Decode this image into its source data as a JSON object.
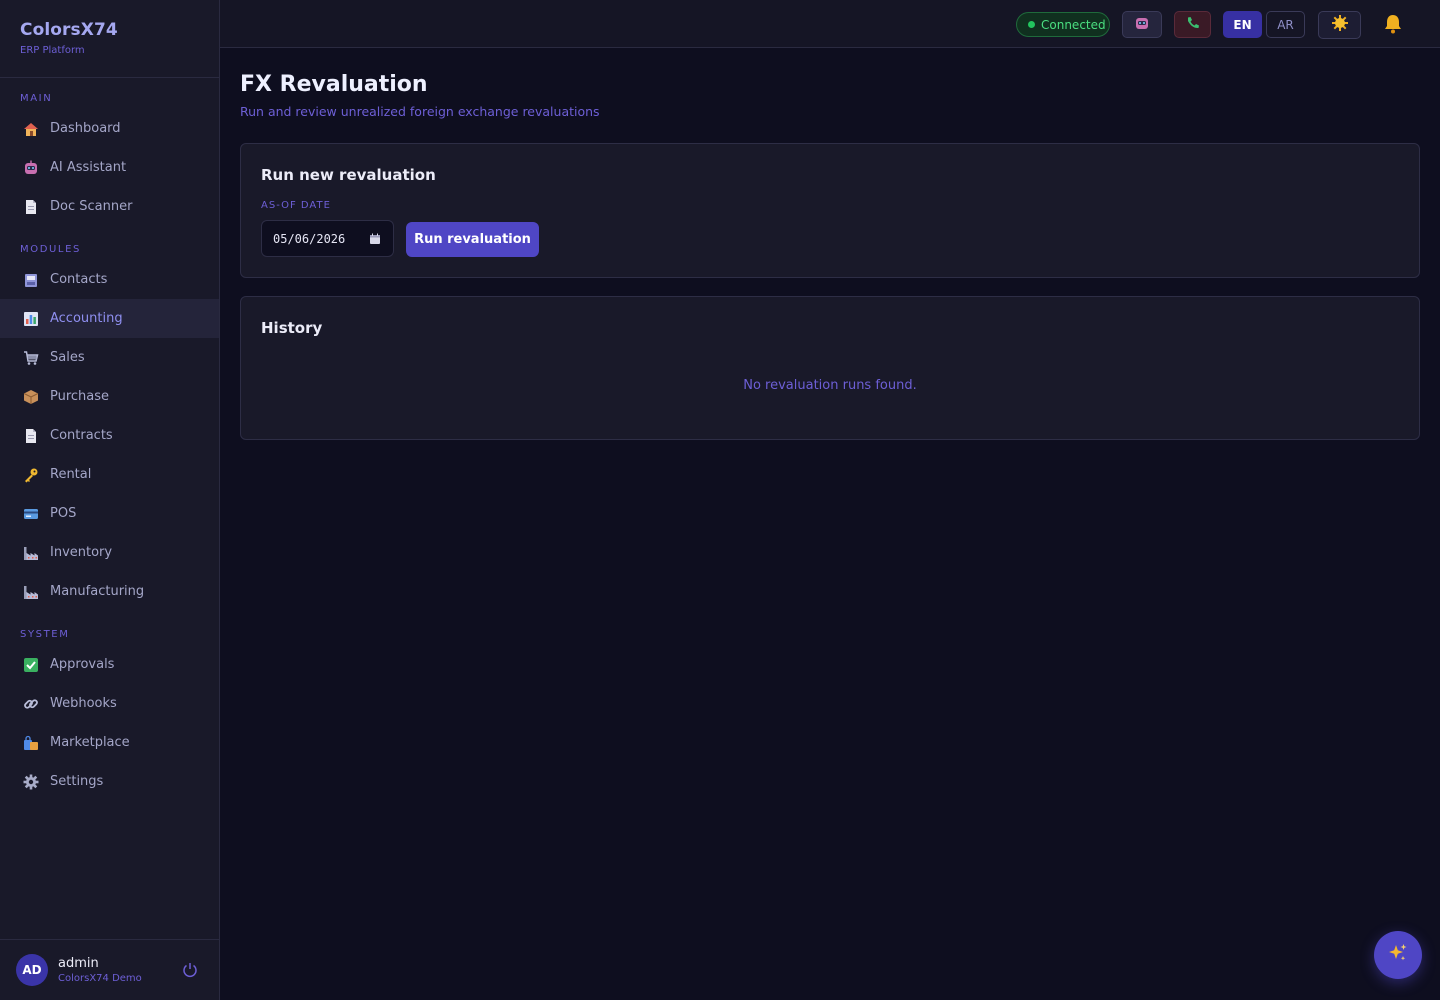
{
  "brand": {
    "title": "ColorsX74",
    "subtitle": "ERP Platform"
  },
  "sidebar": {
    "sections": [
      {
        "label": "MAIN",
        "items": [
          {
            "label": "Dashboard",
            "icon": "house-icon"
          },
          {
            "label": "AI Assistant",
            "icon": "robot-icon"
          },
          {
            "label": "Doc Scanner",
            "icon": "document-icon"
          }
        ]
      },
      {
        "label": "MODULES",
        "items": [
          {
            "label": "Contacts",
            "icon": "address-book-icon"
          },
          {
            "label": "Accounting",
            "icon": "bar-chart-icon",
            "active": true
          },
          {
            "label": "Sales",
            "icon": "shopping-cart-icon"
          },
          {
            "label": "Purchase",
            "icon": "package-icon"
          },
          {
            "label": "Contracts",
            "icon": "document-icon"
          },
          {
            "label": "Rental",
            "icon": "key-icon"
          },
          {
            "label": "POS",
            "icon": "credit-card-icon"
          },
          {
            "label": "Inventory",
            "icon": "factory-icon"
          },
          {
            "label": "Manufacturing",
            "icon": "factory-icon"
          }
        ]
      },
      {
        "label": "SYSTEM",
        "items": [
          {
            "label": "Approvals",
            "icon": "check-box-icon"
          },
          {
            "label": "Webhooks",
            "icon": "link-icon"
          },
          {
            "label": "Marketplace",
            "icon": "shopping-bags-icon"
          },
          {
            "label": "Settings",
            "icon": "gear-icon"
          }
        ]
      }
    ]
  },
  "user": {
    "initials": "AD",
    "name": "admin",
    "org": "ColorsX74 Demo"
  },
  "topbar": {
    "status": "Connected",
    "lang_en": "EN",
    "lang_ar": "AR"
  },
  "page": {
    "title": "FX Revaluation",
    "subtitle": "Run and review unrealized foreign exchange revaluations"
  },
  "run_card": {
    "title": "Run new revaluation",
    "date_label": "AS-OF DATE",
    "date_value": "05/06/2026",
    "button": "Run revaluation"
  },
  "history_card": {
    "title": "History",
    "empty_text": "No revaluation runs found."
  },
  "colors": {
    "accent": "#4f46c5",
    "success": "#22c55e",
    "background": "#0e0e1f",
    "surface": "#191929"
  }
}
